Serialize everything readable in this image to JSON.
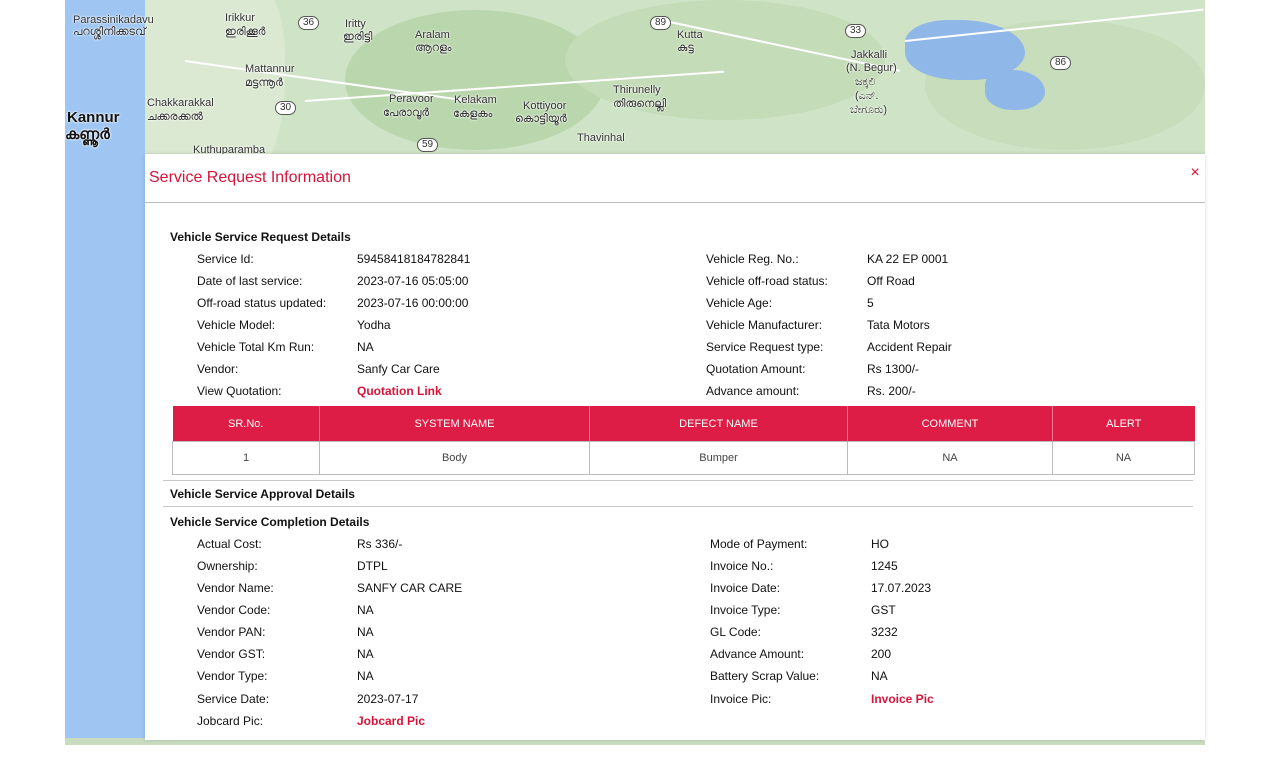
{
  "map": {
    "labels": {
      "parassinikadavu": "Parassinikadavu",
      "parassinikadavu_ml": "പറശ്ശിനിക്കടവ്",
      "irikkur": "Irikkur",
      "irikkur_ml": "ഇരിക്കൂർ",
      "iritty": "Iritty",
      "iritty_ml": "ഇരിട്ടി",
      "aralam": "Aralam",
      "aralam_ml": "ആറളം",
      "mattannur": "Mattannur",
      "mattannur_ml": "മട്ടന്നൂർ",
      "kutta": "Kutta",
      "kutta_ml": "കുട്ട",
      "chakkarakkal": "Chakkarakkal",
      "chakkarakkal_ml": "ചക്കരക്കൽ",
      "kannur": "Kannur",
      "kannur_ml": "കണ്ണൂർ",
      "peravoor": "Peravoor",
      "peravoor_ml": "പേരാവൂർ",
      "kelakam": "Kelakam",
      "kelakam_ml": "കേളകം",
      "kottiyoor": "Kottiyoor",
      "kottiyoor_ml": "കൊട്ടിയൂർ",
      "thirunelly": "Thirunelly",
      "thirunelly_ml": "തിരുനെല്ലി",
      "thavinhal": "Thavinhal",
      "jakkalli": "Jakkalli",
      "n_begur": "(N. Begur)",
      "jakkalli_kn": "ಜಕ್ಕಲಿ",
      "n_kn": "(ಎನ್.",
      "begur_kn": "ಬೇಗೂರು)",
      "kuthuparamba": "Kuthuparamba"
    },
    "shields": [
      "36",
      "89",
      "33",
      "30",
      "86",
      "59"
    ]
  },
  "modal": {
    "title": "Service Request Information",
    "close_glyph": "×",
    "request_section_title": "Vehicle Service Request Details",
    "request_left": [
      {
        "label": "Service Id:",
        "value": "59458418184782841"
      },
      {
        "label": "Date of last service:",
        "value": "2023-07-16 05:05:00"
      },
      {
        "label": "Off-road status updated:",
        "value": "2023-07-16 00:00:00"
      },
      {
        "label": "Vehicle Model:",
        "value": "Yodha"
      },
      {
        "label": "Vehicle Total Km Run:",
        "value": "NA"
      },
      {
        "label": "Vendor:",
        "value": "Sanfy Car Care"
      },
      {
        "label": "View Quotation:",
        "value": "Quotation Link"
      }
    ],
    "request_right": [
      {
        "label": "Vehicle Reg. No.:",
        "value": "KA 22 EP 0001"
      },
      {
        "label": "Vehicle off-road status:",
        "value": "Off Road"
      },
      {
        "label": "Vehicle Age:",
        "value": "5"
      },
      {
        "label": "Vehicle Manufacturer:",
        "value": "Tata Motors"
      },
      {
        "label": "Service Request type:",
        "value": "Accident Repair"
      },
      {
        "label": "Quotation Amount:",
        "value": "Rs 1300/-"
      },
      {
        "label": "Advance amount:",
        "value": "Rs. 200/-"
      }
    ],
    "defect_table": {
      "headers": [
        "SR.No.",
        "SYSTEM NAME",
        "DEFECT NAME",
        "COMMENT",
        "ALERT"
      ],
      "rows": [
        [
          "1",
          "Body",
          "Bumper",
          "NA",
          "NA"
        ]
      ]
    },
    "approval_section_title": "Vehicle Service Approval Details",
    "completion_section_title": "Vehicle Service Completion Details",
    "completion_left": [
      {
        "label": "Actual Cost:",
        "value": "Rs 336/-"
      },
      {
        "label": "Ownership:",
        "value": "DTPL"
      },
      {
        "label": "Vendor Name:",
        "value": "SANFY CAR CARE"
      },
      {
        "label": "Vendor Code:",
        "value": "NA"
      },
      {
        "label": "Vendor PAN:",
        "value": "NA"
      },
      {
        "label": "Vendor GST:",
        "value": "NA"
      },
      {
        "label": "Vendor Type:",
        "value": "NA"
      },
      {
        "label": "Service Date:",
        "value": "2023-07-17"
      },
      {
        "label": "Jobcard Pic:",
        "value": "Jobcard Pic"
      }
    ],
    "completion_right": [
      {
        "label": "Mode of Payment:",
        "value": "HO"
      },
      {
        "label": "Invoice No.:",
        "value": "1245"
      },
      {
        "label": "Invoice Date:",
        "value": "17.07.2023"
      },
      {
        "label": "Invoice Type:",
        "value": "GST"
      },
      {
        "label": "GL Code:",
        "value": "3232"
      },
      {
        "label": "Advance Amount:",
        "value": "200"
      },
      {
        "label": "Battery Scrap Value:",
        "value": "NA"
      },
      {
        "label": "Invoice Pic:",
        "value": "Invoice Pic"
      }
    ]
  },
  "colors": {
    "accent": "#d6143a",
    "table_header": "#dd1d45",
    "water": "#9fc6f2",
    "land": "#cfe3c6"
  }
}
